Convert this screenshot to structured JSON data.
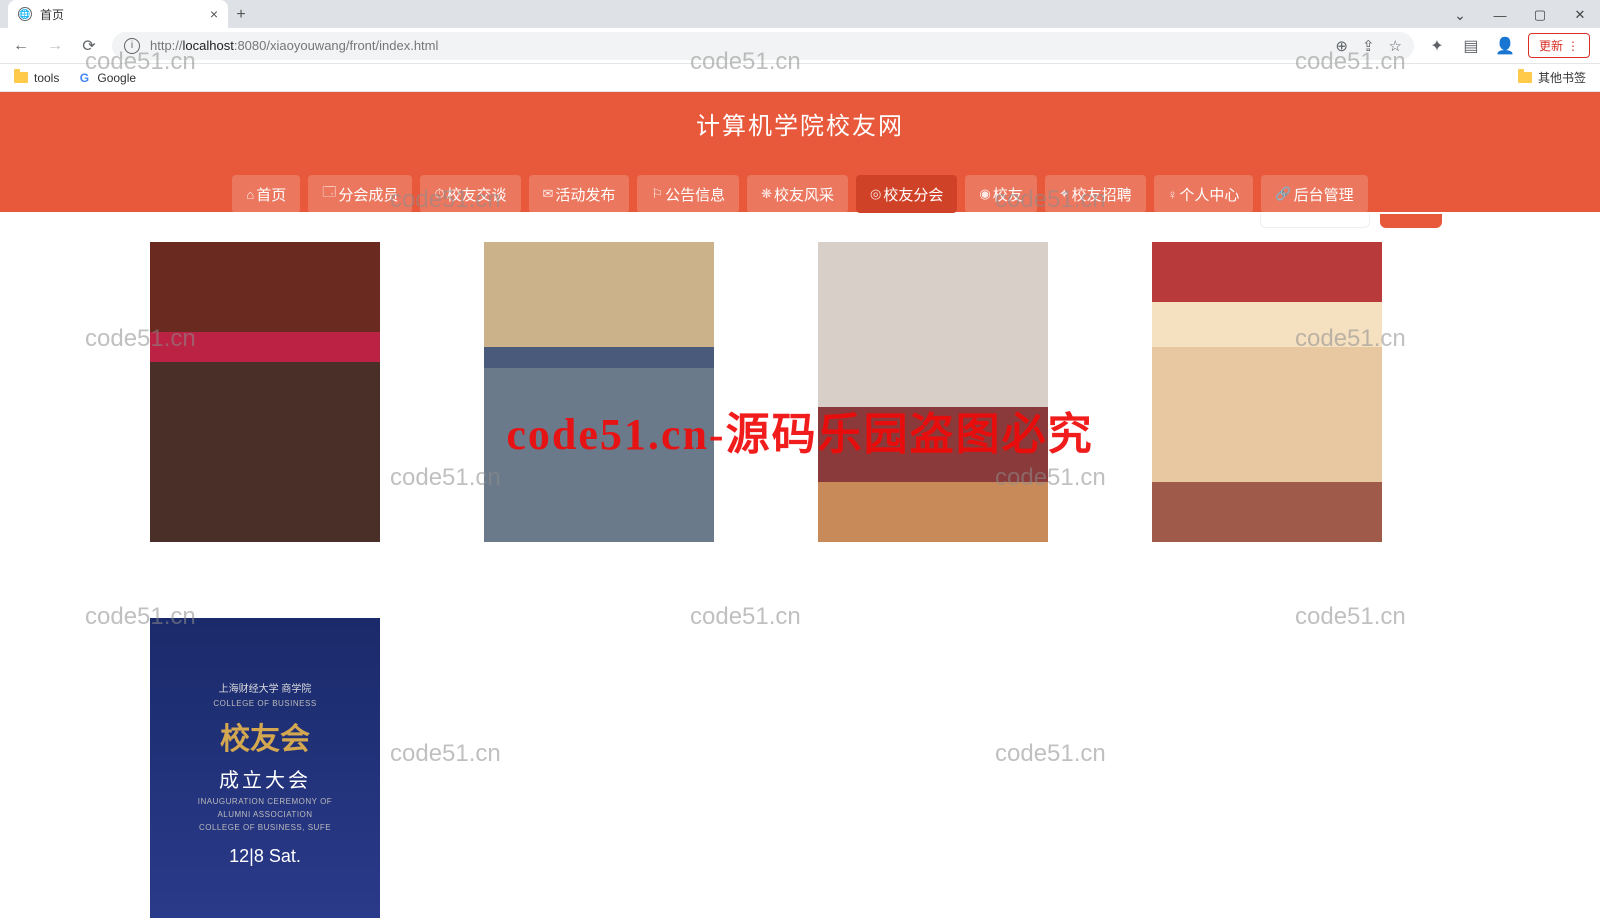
{
  "browser": {
    "tab_title": "首页",
    "url_prefix": "http://",
    "url_host": "localhost",
    "url_port": ":8080",
    "url_path": "/xiaoyouwang/front/index.html",
    "update_label": "更新",
    "bookmarks": {
      "tools": "tools",
      "google": "Google",
      "other": "其他书签"
    }
  },
  "site": {
    "title": "计算机学院校友网",
    "nav": [
      {
        "icon": "⌂",
        "label": "首页"
      },
      {
        "icon": "🗔",
        "label": "分会成员"
      },
      {
        "icon": "⏱",
        "label": "校友交谈"
      },
      {
        "icon": "✉",
        "label": "活动发布"
      },
      {
        "icon": "⚐",
        "label": "公告信息"
      },
      {
        "icon": "❋",
        "label": "校友风采"
      },
      {
        "icon": "◎",
        "label": "校友分会"
      },
      {
        "icon": "◉",
        "label": "校友"
      },
      {
        "icon": "✦",
        "label": "校友招聘"
      },
      {
        "icon": "♀",
        "label": "个人中心"
      },
      {
        "icon": "🔗",
        "label": "后台管理"
      }
    ],
    "active_nav_index": 6
  },
  "card5": {
    "top": "上海财经大学 商学院",
    "top_en": "COLLEGE OF BUSINESS",
    "big": "校友会",
    "mid": "成立大会",
    "sm1": "INAUGURATION CEREMONY OF",
    "sm2": "ALUMNI ASSOCIATION",
    "sm3": "COLLEGE OF BUSINESS, SUFE",
    "date": "12|8 Sat."
  },
  "watermarks": {
    "wm": "code51.cn",
    "center": "code51.cn-源码乐园盗图必究"
  }
}
